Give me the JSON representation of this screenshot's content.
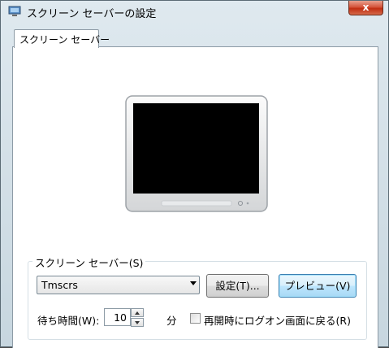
{
  "window": {
    "title": "スクリーン セーバーの設定",
    "close_label": "x"
  },
  "tabs": [
    {
      "label": "スクリーン セーバー",
      "selected": true
    }
  ],
  "screensaver_group": {
    "label": "スクリーン セーバー(S)",
    "selected_value": "Tmscrs",
    "settings_button": "設定(T)...",
    "preview_button": "プレビュー(V)",
    "wait_label": "待ち時間(W):",
    "wait_value": "10",
    "wait_unit": "分",
    "resume_logon_label": "再開時にログオン画面に戻る(R)",
    "resume_logon_checked": false
  },
  "colors": {
    "title_bar": "#dfe9ef",
    "close_button": "#c12e12",
    "preview_button": "#bee6fd",
    "monitor_screen": "#000000"
  }
}
